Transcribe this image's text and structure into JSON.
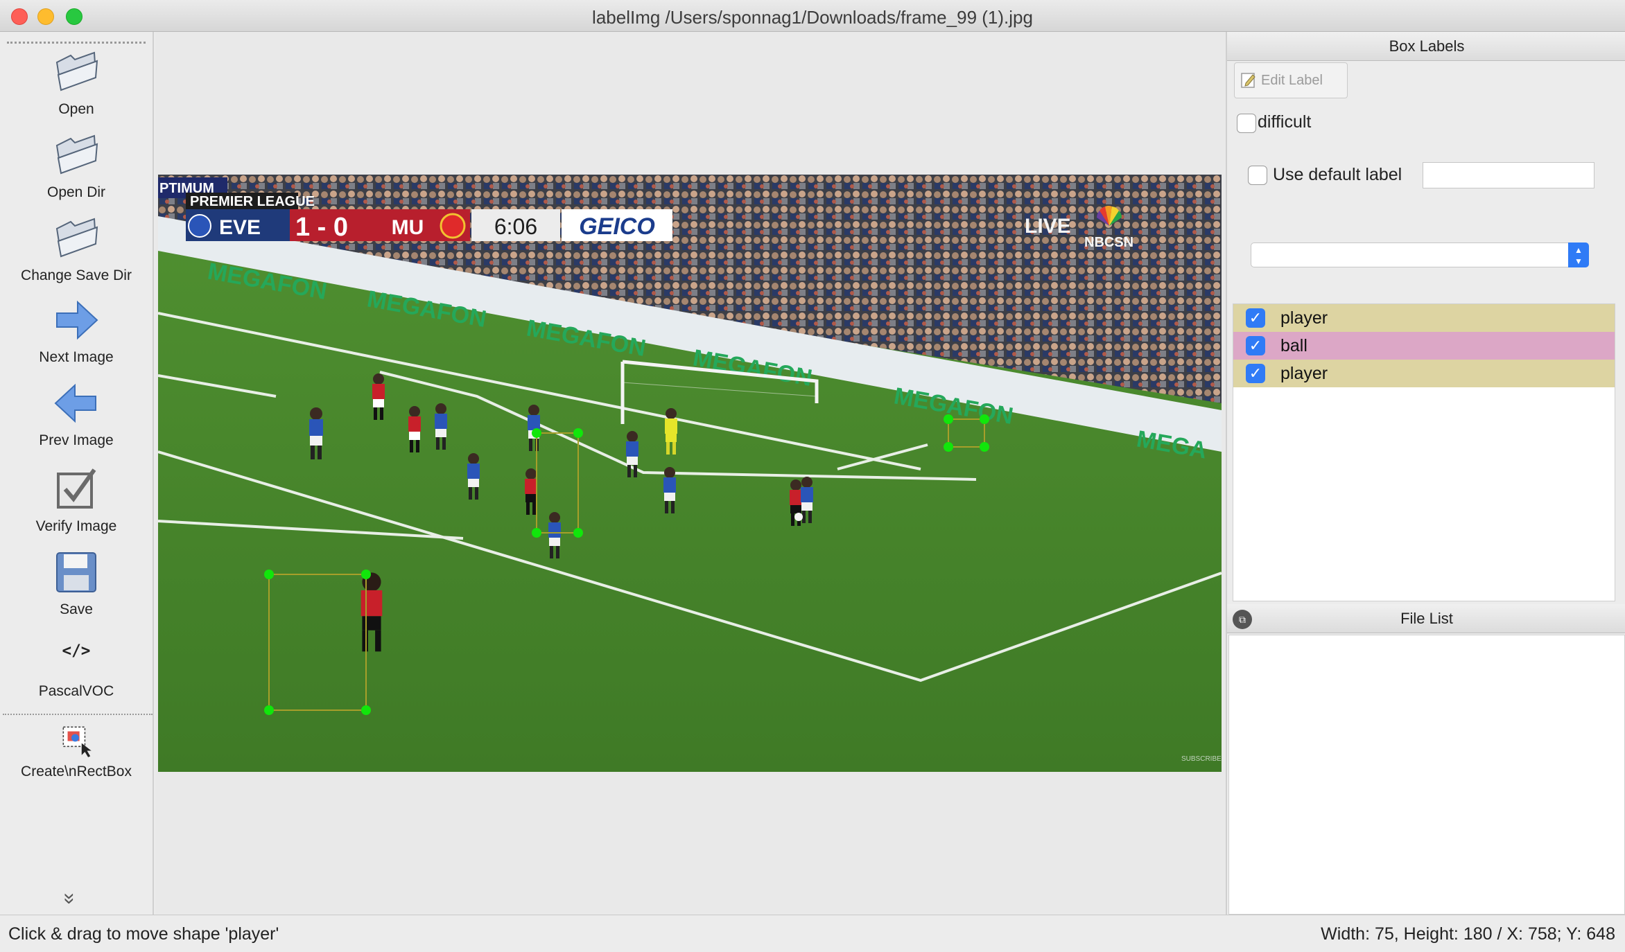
{
  "window": {
    "title": "labelImg /Users/sponnag1/Downloads/frame_99 (1).jpg"
  },
  "toolbar": {
    "items": [
      {
        "label": "Open",
        "icon": "folder-icon"
      },
      {
        "label": "Open Dir",
        "icon": "folder-icon"
      },
      {
        "label": "Change Save Dir",
        "icon": "folder-icon"
      },
      {
        "label": "Next Image",
        "icon": "arrow-right-icon"
      },
      {
        "label": "Prev Image",
        "icon": "arrow-left-icon"
      },
      {
        "label": "Verify Image",
        "icon": "checkbox-icon"
      },
      {
        "label": "Save",
        "icon": "floppy-disk-icon"
      },
      {
        "label": "PascalVOC",
        "icon": "code-icon"
      },
      {
        "label": "Create\\nRectBox",
        "icon": "rect-box-icon"
      }
    ]
  },
  "scene": {
    "scoreboard": {
      "league": "PREMIER LEAGUE",
      "home": "EVE",
      "score": "1 - 0",
      "away": "MU",
      "clock": "6:06",
      "sponsor": "GEICO",
      "corner_text": "PTIMUM"
    },
    "broadcast": {
      "live": "LIVE",
      "network": "NBCSN"
    },
    "ad_board": [
      "MEGAFON",
      "MEGAFON",
      "MEGAFON",
      "MEGAFON",
      "MEGAFON",
      "MEGA"
    ],
    "watermark": "SUBSCRIBE",
    "pitch_color": "#4b8a2e",
    "box_color": "#a79f2a",
    "handle_color": "#11e60b"
  },
  "right_panel": {
    "box_labels_title": "Box Labels",
    "edit_label": "Edit Label",
    "difficult": "difficult",
    "use_default_label": "Use default label",
    "default_label_value": "",
    "combo_value": "",
    "labels": [
      {
        "text": "player",
        "checked": true,
        "color": "#ddd4a2"
      },
      {
        "text": "ball",
        "checked": true,
        "color": "#dca7c6"
      },
      {
        "text": "player",
        "checked": true,
        "color": "#ddd4a2"
      }
    ],
    "file_list_title": "File List"
  },
  "status": {
    "message": "Click & drag to move shape 'player'",
    "coords": "Width: 75, Height: 180 / X: 758; Y: 648"
  }
}
